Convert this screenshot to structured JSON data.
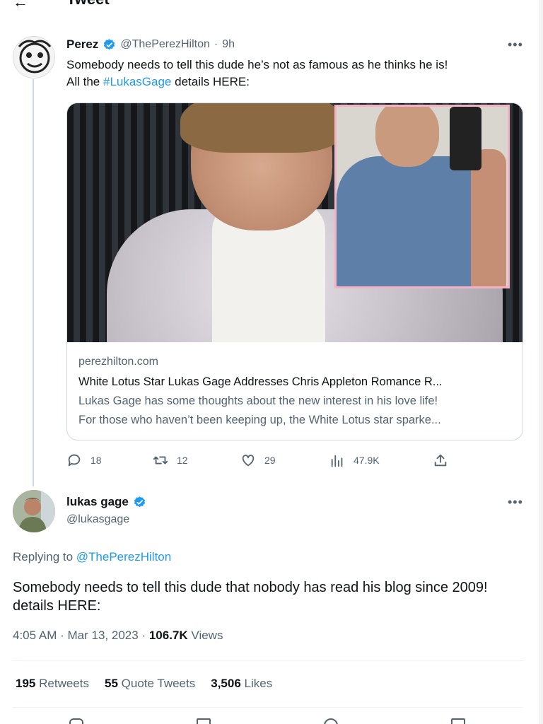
{
  "header": {
    "title": "Tweet"
  },
  "tweet": {
    "author_name": "Perez",
    "author_handle": "@ThePerezHilton",
    "time_ago": "9h",
    "text_line1": "Somebody needs to tell this dude he’s not as famous as he thinks he is!",
    "text_prefix": "All the ",
    "hashtag": "#LukasGage",
    "text_suffix": " details HERE:",
    "card": {
      "domain": "perezhilton.com",
      "title": "White Lotus Star Lukas Gage Addresses Chris Appleton Romance R...",
      "description_line1": "Lukas Gage has some thoughts about the new interest in his love life!",
      "description_line2": "For those who haven’t been keeping up, the White Lotus star sparke..."
    },
    "actions": {
      "replies": "18",
      "retweets": "12",
      "likes": "29",
      "views": "47.9K"
    }
  },
  "reply": {
    "author_name": "lukas gage",
    "author_handle": "@lukasgage",
    "replying_prefix": "Replying to ",
    "replying_to": "@ThePerezHilton",
    "text": "Somebody needs to tell this dude that nobody has read his blog since 2009! details HERE:",
    "time": "4:05 AM",
    "date": "Mar 13, 2023",
    "views_count": "106.7K",
    "views_label": "Views",
    "stats": {
      "retweets_count": "195",
      "retweets_label": "Retweets",
      "quotes_count": "55",
      "quotes_label": "Quote Tweets",
      "likes_count": "3,506",
      "likes_label": "Likes"
    }
  },
  "colors": {
    "link": "#1d9bf0",
    "muted": "#536471",
    "text": "#0f1419",
    "border": "#cfd9de",
    "inset_frame": "#f3b3c4"
  },
  "icons": [
    "back-arrow-icon",
    "verified-badge-icon",
    "more-icon",
    "reply-icon",
    "retweet-icon",
    "like-icon",
    "views-icon",
    "share-icon"
  ]
}
